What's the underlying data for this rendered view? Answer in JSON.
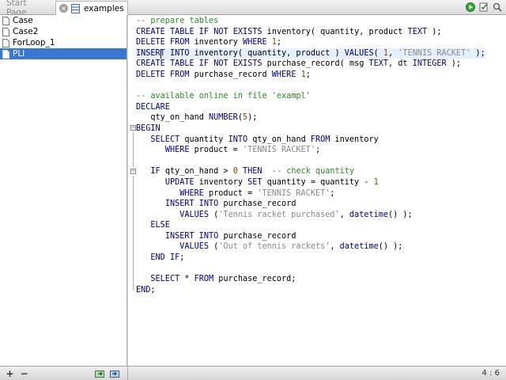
{
  "tabs": [
    {
      "label": "Start Page"
    },
    {
      "label": "examples"
    }
  ],
  "sidebar": {
    "items": [
      {
        "label": "Case"
      },
      {
        "label": "Case2"
      },
      {
        "label": "ForLoop_1"
      },
      {
        "label": "PLI"
      }
    ],
    "selected": "PLI"
  },
  "editor": {
    "lines": [
      "-- prepare tables",
      "CREATE TABLE IF NOT EXISTS inventory( quantity, product TEXT );",
      "DELETE FROM inventory WHERE 1;",
      "INSERT INTO inventory( quantity, product ) VALUES( 1, 'TENNIS RACKET' );",
      "CREATE TABLE IF NOT EXISTS purchase_record( msg TEXT, dt INTEGER );",
      "DELETE FROM purchase_record WHERE 1;",
      "",
      "-- available online in file 'exampl'",
      "DECLARE",
      "   qty_on_hand NUMBER(5);",
      "BEGIN",
      "   SELECT quantity INTO qty_on_hand FROM inventory",
      "      WHERE product = 'TENNIS RACKET';",
      "",
      "   IF qty_on_hand > 0 THEN  -- check quantity",
      "      UPDATE inventory SET quantity = quantity - 1",
      "         WHERE product = 'TENNIS RACKET';",
      "      INSERT INTO purchase_record",
      "         VALUES ('Tennis racket purchased', datetime() );",
      "   ELSE",
      "      INSERT INTO purchase_record",
      "         VALUES ('Out of tennis rackets', datetime() );",
      "   END IF;",
      "",
      "   SELECT * FROM purchase_record;",
      "END;"
    ]
  },
  "status": {
    "cursor": "4 : 6"
  },
  "icons": {
    "run": "play-icon",
    "save": "save-icon",
    "search": "search-icon",
    "add": "plus",
    "remove": "minus"
  },
  "colors": {
    "keyword": "#00007f",
    "comment": "#2e8b2e",
    "string": "#8a8a8a",
    "selection": "#3a78d0"
  }
}
